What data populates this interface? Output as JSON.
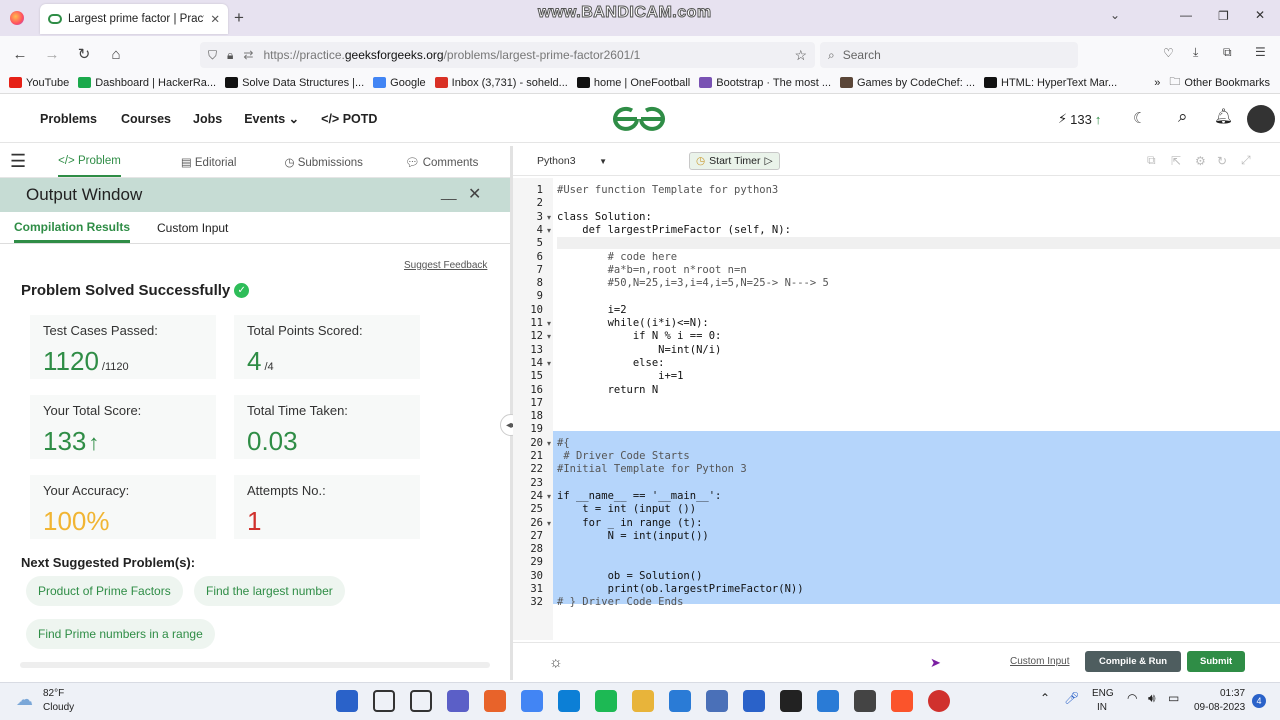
{
  "browser": {
    "tab_title": "Largest prime factor | Practice |",
    "watermark": "www.BANDICAM.com",
    "url_prefix": "https://practice.",
    "url_domain": "geeksforgeeks.org",
    "url_path": "/problems/largest-prime-factor2601/1",
    "search_placeholder": "Search",
    "bookmarks": [
      "YouTube",
      "Dashboard | HackerRa...",
      "Solve Data Structures |...",
      "Google",
      "Inbox (3,731) - soheld...",
      "home | OneFootball",
      "Bootstrap · The most ...",
      "Games by CodeChef: ...",
      "HTML: HyperText Mar..."
    ],
    "bookmark_colors": [
      "#e62117",
      "#1ba94c",
      "#111111",
      "#4285f4",
      "#d93025",
      "#111111",
      "#7952b3",
      "#5b4638",
      "#111111"
    ],
    "other_bookmarks": "Other Bookmarks"
  },
  "site": {
    "nav": [
      "Problems",
      "Courses",
      "Jobs",
      "Events",
      "POTD"
    ],
    "potd_prefix": "</>",
    "streak": "133",
    "brand_color": "#2f8d46"
  },
  "left": {
    "tabs": [
      "Problem",
      "Editorial",
      "Submissions",
      "Comments"
    ],
    "output_title": "Output Window",
    "minimize": "__",
    "result_tabs": [
      "Compilation Results",
      "Custom Input"
    ],
    "suggest_feedback": "Suggest Feedback",
    "status": "Problem Solved Successfully",
    "cards": [
      {
        "label": "Test Cases Passed:",
        "value": "1120",
        "suffix": "/1120",
        "color": "#2f8d46"
      },
      {
        "label": "Total Points Scored:",
        "value": "4",
        "suffix": "/4",
        "color": "#2f8d46"
      },
      {
        "label": "Your Total Score:",
        "value": "133",
        "suffix": "",
        "color": "#2f8d46"
      },
      {
        "label": "Total Time Taken:",
        "value": "0.03",
        "suffix": "",
        "color": "#2f8d46"
      },
      {
        "label": "Your Accuracy:",
        "value": "100%",
        "suffix": "",
        "color": "#f1b533"
      },
      {
        "label": "Attempts No.:",
        "value": "1",
        "suffix": "",
        "color": "#d0312d"
      }
    ],
    "next_title": "Next Suggested Problem(s):",
    "suggestions": [
      "Product of Prime Factors",
      "Find the largest number",
      "Find Prime numbers in a range"
    ]
  },
  "editor": {
    "language": "Python3",
    "timer": "Start Timer",
    "lines": [
      "#User function Template for python3",
      "",
      "class Solution:",
      "    def largestPrimeFactor (self, N):",
      "        ",
      "        # code here",
      "        #a*b=n,root n*root n=n",
      "        #50,N=25,i=3,i=4,i=5,N=25-> N---> 5",
      "",
      "        i=2",
      "        while((i*i)<=N):",
      "            if N % i == 0:",
      "                N=int(N/i)",
      "            else:",
      "                i+=1",
      "        return N",
      "",
      "",
      "",
      "#{",
      " # Driver Code Starts",
      "#Initial Template for Python 3",
      "",
      "if __name__ == '__main__':",
      "    t = int (input ())",
      "    for _ in range (t):",
      "        N = int(input())",
      "",
      "",
      "        ob = Solution()",
      "        print(ob.largestPrimeFactor(N))",
      "# } Driver Code Ends"
    ],
    "fold_lines": [
      3,
      4,
      11,
      12,
      14,
      20,
      24,
      26
    ],
    "custom_input": "Custom Input",
    "compile_run": "Compile & Run",
    "submit": "Submit"
  },
  "taskbar": {
    "temp": "82°F",
    "weather": "Cloudy",
    "lang": "ENG",
    "region": "IN",
    "time": "01:37",
    "date": "09-08-2023",
    "notif": "4"
  }
}
